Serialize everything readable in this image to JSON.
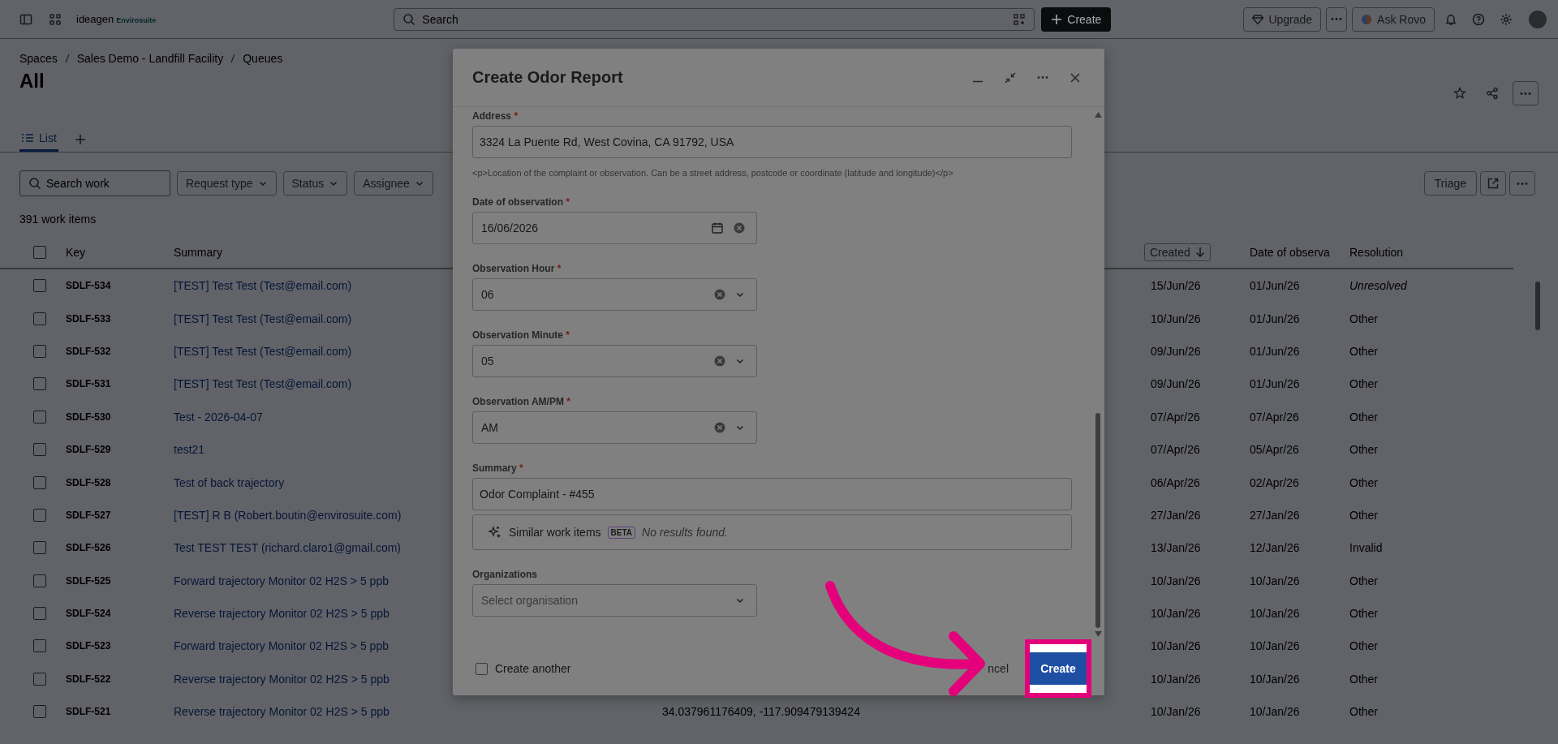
{
  "topbar": {
    "logo": {
      "name": "ideagen",
      "sub": "Envirosuite"
    },
    "search": {
      "placeholder": "Search"
    },
    "create_label": "Create",
    "upgrade_label": "Upgrade",
    "rovo_label": "Ask Rovo"
  },
  "page": {
    "breadcrumbs": [
      "Spaces",
      "Sales Demo - Landfill Facility",
      "Queues"
    ],
    "title": "All",
    "tabs": [
      {
        "label": "List",
        "selected": true
      }
    ],
    "filters": {
      "search_placeholder": "Search work",
      "dropdowns": [
        "Request type",
        "Status",
        "Assignee"
      ]
    },
    "triage_label": "Triage",
    "count": "391 work items"
  },
  "table": {
    "select_all_checked": false,
    "columns": {
      "key": "Key",
      "summary": "Summary",
      "created": "Created",
      "date_of_observa": "Date of observa",
      "resolution": "Resolution"
    },
    "rows": [
      {
        "key": "SDLF-534",
        "summary": "[TEST] Test Test (Test@email.com)",
        "created": "15/Jun/26",
        "date_of_observa": "01/Jun/26",
        "resolution": "Unresolved",
        "unresolved": true,
        "checked": false
      },
      {
        "key": "SDLF-533",
        "summary": "[TEST] Test Test (Test@email.com)",
        "created": "10/Jun/26",
        "date_of_observa": "01/Jun/26",
        "resolution": "Other",
        "unresolved": false,
        "checked": false
      },
      {
        "key": "SDLF-532",
        "summary": "[TEST] Test Test (Test@email.com)",
        "created": "09/Jun/26",
        "date_of_observa": "01/Jun/26",
        "resolution": "Other",
        "unresolved": false,
        "checked": false
      },
      {
        "key": "SDLF-531",
        "summary": "[TEST] Test Test (Test@email.com)",
        "created": "09/Jun/26",
        "date_of_observa": "01/Jun/26",
        "resolution": "Other",
        "unresolved": false,
        "checked": false
      },
      {
        "key": "SDLF-530",
        "summary": "Test - 2026-04-07",
        "created": "07/Apr/26",
        "date_of_observa": "07/Apr/26",
        "resolution": "Other",
        "unresolved": false,
        "checked": false
      },
      {
        "key": "SDLF-529",
        "summary": "test21",
        "created": "07/Apr/26",
        "date_of_observa": "05/Apr/26",
        "resolution": "Other",
        "unresolved": false,
        "checked": false
      },
      {
        "key": "SDLF-528",
        "summary": "Test of back trajectory",
        "created": "06/Apr/26",
        "date_of_observa": "02/Apr/26",
        "resolution": "Other",
        "unresolved": false,
        "checked": false
      },
      {
        "key": "SDLF-527",
        "summary": "[TEST] R B (Robert.boutin@envirosuite.com)",
        "created": "27/Jan/26",
        "date_of_observa": "27/Jan/26",
        "resolution": "Other",
        "unresolved": false,
        "checked": false
      },
      {
        "key": "SDLF-526",
        "summary": "Test TEST TEST (richard.claro1@gmail.com)",
        "created": "13/Jan/26",
        "date_of_observa": "12/Jan/26",
        "resolution": "Invalid",
        "unresolved": false,
        "checked": false
      },
      {
        "key": "SDLF-525",
        "summary": "Forward trajectory Monitor 02 H2S > 5 ppb",
        "created": "10/Jan/26",
        "date_of_observa": "10/Jan/26",
        "resolution": "Other",
        "unresolved": false,
        "checked": false
      },
      {
        "key": "SDLF-524",
        "summary": "Reverse trajectory Monitor 02 H2S > 5 ppb",
        "created": "10/Jan/26",
        "date_of_observa": "10/Jan/26",
        "resolution": "Other",
        "unresolved": false,
        "checked": false
      },
      {
        "key": "SDLF-523",
        "summary": "Forward trajectory Monitor 02 H2S > 5 ppb",
        "created": "10/Jan/26",
        "date_of_observa": "10/Jan/26",
        "resolution": "Other",
        "unresolved": false,
        "checked": false
      },
      {
        "key": "SDLF-522",
        "summary": "Reverse trajectory Monitor 02 H2S > 5 ppb",
        "created": "10/Jan/26",
        "date_of_observa": "10/Jan/26",
        "resolution": "Other",
        "unresolved": false,
        "checked": false
      },
      {
        "key": "SDLF-521",
        "summary": "Reverse trajectory Monitor 02 H2S > 5 ppb",
        "column_4": "34.037961176409, -117.909479139424",
        "created": "10/Jan/26",
        "date_of_observa": "10/Jan/26",
        "resolution": "Other",
        "unresolved": false,
        "checked": false
      }
    ]
  },
  "modal": {
    "title": "Create Odor Report",
    "fields": [
      {
        "kind": "text",
        "label": "Address",
        "required_mark": "*",
        "value": "3324 La Puente Rd, West Covina, CA 91792, USA",
        "help": "<p>Location of the complaint or observation. Can be a street address, postcode or coordinate (latitude and longitude)</p>"
      },
      {
        "kind": "date",
        "label": "Date of observation",
        "required_mark": "*",
        "value": "16/06/2026"
      },
      {
        "kind": "select",
        "label": "Observation Hour",
        "required_mark": "*",
        "value": "06"
      },
      {
        "kind": "select",
        "label": "Observation Minute",
        "required_mark": "*",
        "value": "05"
      },
      {
        "kind": "select",
        "label": "Observation AM/PM",
        "required_mark": "*",
        "value": "AM"
      },
      {
        "kind": "summary",
        "label": "Summary",
        "required_mark": "*",
        "value": "Odor Complaint - #455",
        "similar": {
          "label": "Similar work items",
          "badge": "BETA",
          "result": "No results found."
        }
      },
      {
        "kind": "select",
        "label": "Organizations",
        "placeholder": "Select organisation"
      }
    ],
    "create_another": {
      "label": "Create another",
      "checked": false
    },
    "cancel_label": "ncel",
    "create_label": "Create"
  }
}
